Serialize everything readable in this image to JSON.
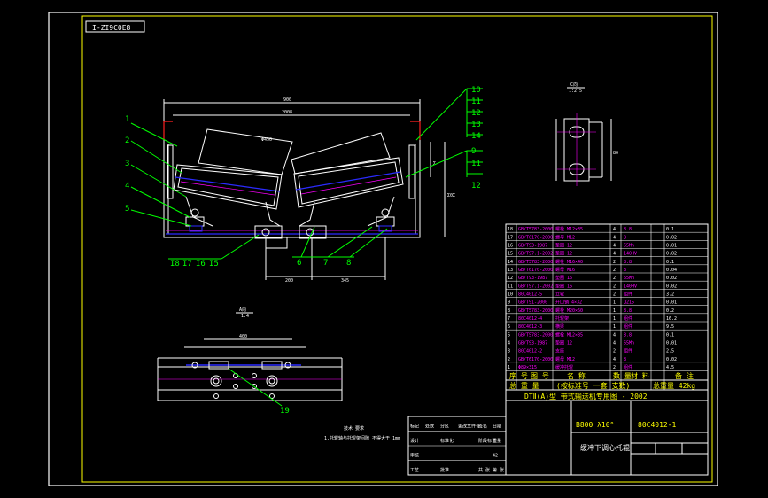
{
  "drawing_number_box": "I-ZI9C0E8",
  "section_label": {
    "name": "C向",
    "scale": "1:2.5"
  },
  "view_a_label": {
    "name": "A向",
    "scale": "1:4"
  },
  "top_dims": [
    "900",
    "2008"
  ],
  "callouts_left": [
    "1",
    "2",
    "3",
    "4",
    "5"
  ],
  "callouts_bottom_left": [
    "I8",
    "I7",
    "I6",
    "I5"
  ],
  "callouts_bottom_mid": [
    "6",
    "7",
    "8"
  ],
  "callouts_right_top": [
    "10",
    "11",
    "12",
    "13",
    "14"
  ],
  "callouts_right_mid": [
    "9",
    "11",
    "12"
  ],
  "callout_view_a": "19",
  "notes": [
    "技术 要求",
    "1.托辊轴与托辊架间隙 不得大于 1mm"
  ],
  "title_block": {
    "series": "DTⅡ(A)型 带式输送机专用图 - 2002",
    "spec": "B800 λ10°",
    "code": "80C4012-1",
    "name": "缓冲下调心托辊",
    "header": [
      "序 号",
      "图 号",
      "名 称",
      "数 量",
      "材 料",
      "备 注"
    ],
    "weight_row": [
      "总 重 量",
      "(按标准号 一套 支数)",
      "总重量 42kg"
    ]
  },
  "parts_rows": [
    [
      "18",
      "GB/T5783-2000",
      "螺栓 M12×35",
      "4",
      "8.8",
      "0.1"
    ],
    [
      "17",
      "GB/T6170-2000",
      "螺母 M12",
      "4",
      "8",
      "0.02"
    ],
    [
      "16",
      "GB/T93-1987",
      "垫圈 12",
      "4",
      "65Mn",
      "0.01"
    ],
    [
      "15",
      "GB/T97.1-2002",
      "垫圈 12",
      "4",
      "140HV",
      "0.02"
    ],
    [
      "14",
      "GB/T5783-2000",
      "螺栓 M16×40",
      "2",
      "8.8",
      "0.1"
    ],
    [
      "13",
      "GB/T6170-2000",
      "螺母 M16",
      "2",
      "8",
      "0.04"
    ],
    [
      "12",
      "GB/T93-1987",
      "垫圈 16",
      "2",
      "65Mn",
      "0.02"
    ],
    [
      "11",
      "GB/T97.1-2002",
      "垫圈 16",
      "2",
      "140HV",
      "0.02"
    ],
    [
      "10",
      "80C4012-5",
      "立辊",
      "2",
      "组件",
      "3.2"
    ],
    [
      "9",
      "GB/T91-2000",
      "开口销 4×32",
      "1",
      "Q215",
      "0.01"
    ],
    [
      "8",
      "GB/T5783-2000",
      "螺栓 M20×60",
      "1",
      "8.8",
      "0.2"
    ],
    [
      "7",
      "80C4012-4",
      "托辊架",
      "1",
      "组件",
      "16.2"
    ],
    [
      "6",
      "80C4012-3",
      "横梁",
      "1",
      "组件",
      "9.5"
    ],
    [
      "5",
      "GB/T5783-2000",
      "螺栓 M12×35",
      "4",
      "8.8",
      "0.1"
    ],
    [
      "4",
      "GB/T93-1987",
      "垫圈 12",
      "4",
      "65Mn",
      "0.01"
    ],
    [
      "3",
      "80C4012-2",
      "支座",
      "2",
      "组件",
      "2.5"
    ],
    [
      "2",
      "GB/T6170-2000",
      "螺母 M12",
      "4",
      "8",
      "0.02"
    ],
    [
      "1",
      "Φ89×315",
      "缓冲托辊",
      "2",
      "组件",
      "4.5"
    ]
  ],
  "revision_rows": [
    [
      "标记",
      "处数",
      "分区",
      "更改文件号",
      "签名",
      "日期"
    ],
    [
      "设计",
      "",
      "标准化",
      "",
      "阶段标记",
      "重量"
    ],
    [
      "审核",
      "",
      "",
      "",
      "",
      "42"
    ],
    [
      "工艺",
      "",
      "批准",
      "",
      "共 张",
      "第 张"
    ]
  ]
}
